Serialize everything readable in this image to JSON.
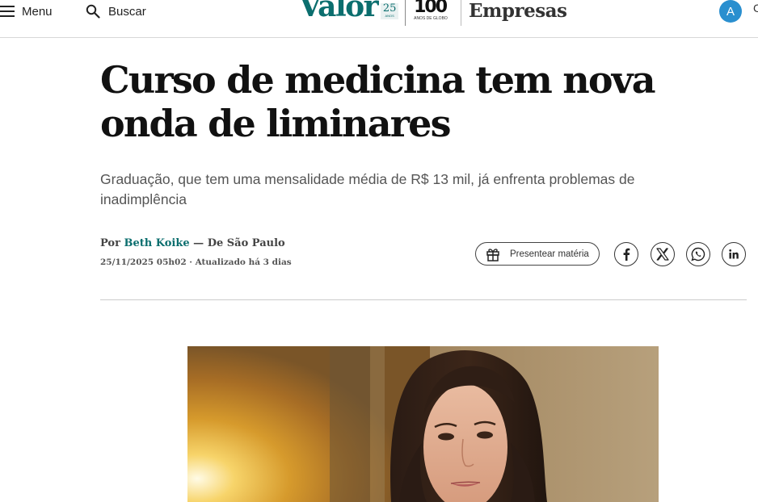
{
  "header": {
    "menu_label": "Menu",
    "search_label": "Buscar",
    "logo": {
      "brand": "Valor",
      "anniversary_number": "25",
      "anniversary_text": "ANOS",
      "centenary_number": "100",
      "centenary_text": "ANOS DE GLOBO"
    },
    "section": "Empresas",
    "avatar_initial": "A",
    "edge_char": "C"
  },
  "article": {
    "title": "Curso de medicina tem nova onda de liminares",
    "subtitle": "Graduação, que tem uma mensalidade média de R$ 13 mil, já enfrenta problemas de inadimplência",
    "byline_prefix": "Por ",
    "author": "Beth Koike",
    "byline_suffix": " — De São Paulo",
    "date": "25/11/2025 05h02 · Atualizado há 3 dias",
    "gift_label": "Presentear matéria"
  },
  "share": {
    "icons": [
      "facebook-icon",
      "x-icon",
      "whatsapp-icon",
      "linkedin-icon"
    ]
  },
  "colors": {
    "brand_teal": "#0b6e6e",
    "avatar_blue": "#2a8fcf",
    "headline": "#111111"
  }
}
